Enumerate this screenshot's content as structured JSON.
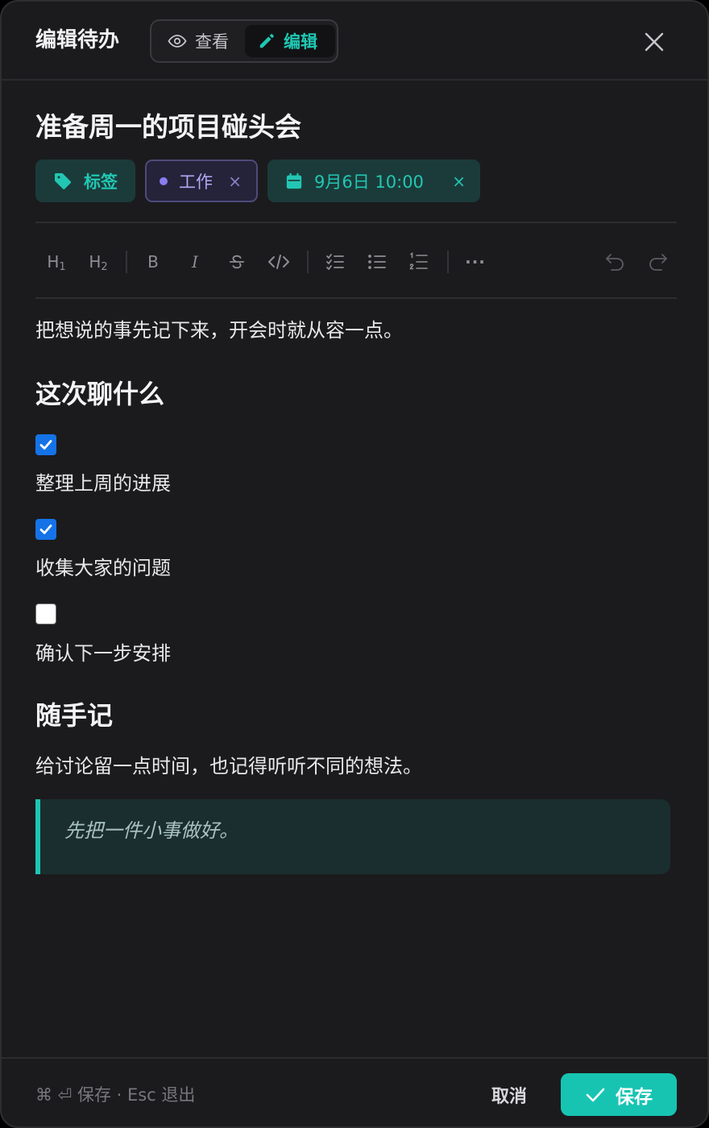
{
  "header": {
    "title": "编辑待办",
    "modes": {
      "view": "查看",
      "edit": "编辑"
    },
    "active_mode": "edit"
  },
  "doc": {
    "title": "准备周一的项目碰头会",
    "chips": {
      "label": "标签",
      "category": "工作",
      "date": "9月6日 10:00",
      "remove": "×"
    }
  },
  "toolbar": {
    "h1": "H",
    "h1_sub": "1",
    "h2": "H",
    "h2_sub": "2",
    "bold": "B",
    "italic": "I",
    "more": "···"
  },
  "content": {
    "intro": "把想说的事先记下来，开会时就从容一点。",
    "section1_heading": "这次聊什么",
    "todos": [
      {
        "text": "整理上周的进展",
        "checked": true
      },
      {
        "text": "收集大家的问题",
        "checked": true
      },
      {
        "text": "确认下一步安排",
        "checked": false
      }
    ],
    "section2_heading": "随手记",
    "note": "给讨论留一点时间，也记得听听不同的想法。",
    "quote": "先把一件小事做好。"
  },
  "footer": {
    "hint": "⌘ ⏎ 保存 · Esc 退出",
    "cancel": "取消",
    "save": "保存"
  },
  "colors": {
    "accent": "#17c4b2",
    "checkbox": "#1573e8",
    "category": "#8a7cf0",
    "background": "#1b1b1d"
  }
}
